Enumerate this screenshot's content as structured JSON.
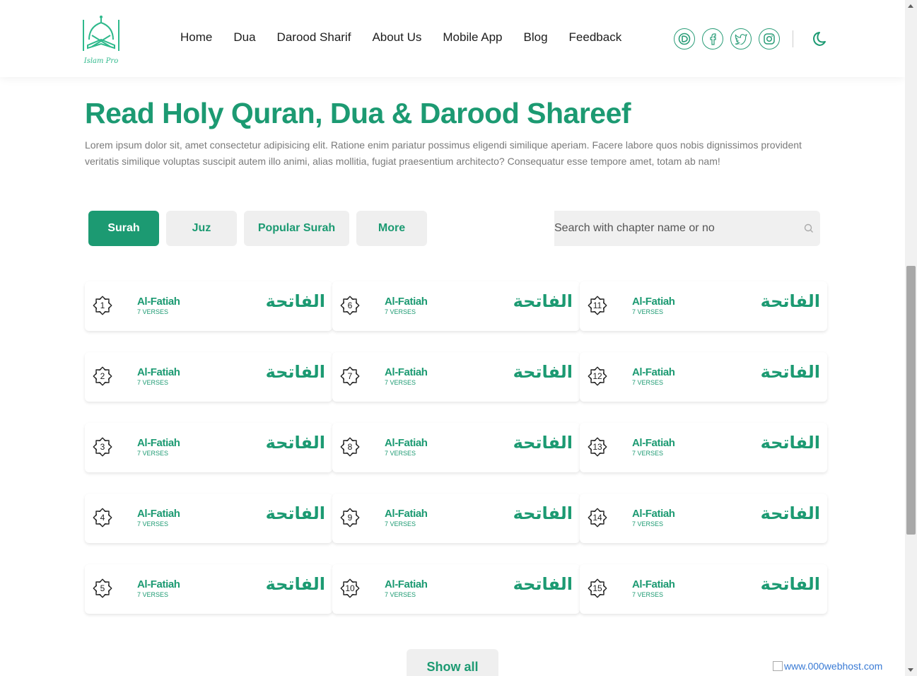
{
  "header": {
    "logo_text": "Islam Pro",
    "nav": [
      "Home",
      "Dua",
      "Darood Sharif",
      "About Us",
      "Mobile App",
      "Blog",
      "Feedback"
    ],
    "socials": [
      "dribbble-icon",
      "facebook-icon",
      "twitter-icon",
      "instagram-icon"
    ],
    "theme_toggle_icon": "moon-icon"
  },
  "hero": {
    "title": "Read Holy Quran, Dua & Darood Shareef",
    "description": "Lorem ipsum dolor sit, amet consectetur adipisicing elit. Ratione enim pariatur possimus eligendi similique aperiam. Facere labore quos nobis dignissimos provident veritatis similique voluptas suscipit autem illo animi, alias mollitia, fugiat praesentium architecto? Consequatur esse tempore amet, totam ab nam!"
  },
  "tabs": [
    {
      "label": "Surah",
      "active": true
    },
    {
      "label": "Juz",
      "active": false
    },
    {
      "label": "Popular Surah",
      "active": false
    },
    {
      "label": "More",
      "active": false
    }
  ],
  "search": {
    "placeholder": "Search with chapter name or no"
  },
  "surahs": [
    {
      "number": "1",
      "name": "Al-Fatiah",
      "verses": "7 VERSES",
      "arabic": "الفاتحة"
    },
    {
      "number": "2",
      "name": "Al-Fatiah",
      "verses": "7 VERSES",
      "arabic": "الفاتحة"
    },
    {
      "number": "3",
      "name": "Al-Fatiah",
      "verses": "7 VERSES",
      "arabic": "الفاتحة"
    },
    {
      "number": "4",
      "name": "Al-Fatiah",
      "verses": "7 VERSES",
      "arabic": "الفاتحة"
    },
    {
      "number": "5",
      "name": "Al-Fatiah",
      "verses": "7 VERSES",
      "arabic": "الفاتحة"
    },
    {
      "number": "6",
      "name": "Al-Fatiah",
      "verses": "7 VERSES",
      "arabic": "الفاتحة"
    },
    {
      "number": "7",
      "name": "Al-Fatiah",
      "verses": "7 VERSES",
      "arabic": "الفاتحة"
    },
    {
      "number": "8",
      "name": "Al-Fatiah",
      "verses": "7 VERSES",
      "arabic": "الفاتحة"
    },
    {
      "number": "9",
      "name": "Al-Fatiah",
      "verses": "7 VERSES",
      "arabic": "الفاتحة"
    },
    {
      "number": "10",
      "name": "Al-Fatiah",
      "verses": "7 VERSES",
      "arabic": "الفاتحة"
    },
    {
      "number": "11",
      "name": "Al-Fatiah",
      "verses": "7 VERSES",
      "arabic": "الفاتحة"
    },
    {
      "number": "12",
      "name": "Al-Fatiah",
      "verses": "7 VERSES",
      "arabic": "الفاتحة"
    },
    {
      "number": "13",
      "name": "Al-Fatiah",
      "verses": "7 VERSES",
      "arabic": "الفاتحة"
    },
    {
      "number": "14",
      "name": "Al-Fatiah",
      "verses": "7 VERSES",
      "arabic": "الفاتحة"
    },
    {
      "number": "15",
      "name": "Al-Fatiah",
      "verses": "7 VERSES",
      "arabic": "الفاتحة"
    }
  ],
  "show_all_label": "Show all",
  "watermark": "www.000webhost.com",
  "colors": {
    "accent": "#1c9a72",
    "tab_bg": "#efefef",
    "social_border": "#2a9d78"
  }
}
